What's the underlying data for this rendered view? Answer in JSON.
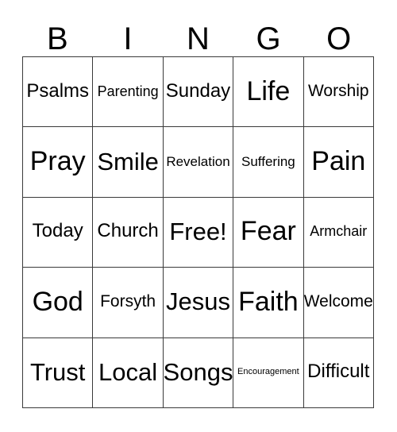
{
  "card": {
    "type": "bingo-card",
    "header_letters": [
      "B",
      "I",
      "N",
      "G",
      "O"
    ],
    "grid_size": "5x5",
    "colors": {
      "background": "#ffffff",
      "text": "#000000",
      "grid_line": "#3a3a3a"
    },
    "rows": [
      [
        {
          "label": "Psalms",
          "size": "md"
        },
        {
          "label": "Parenting",
          "size": "xs"
        },
        {
          "label": "Sunday",
          "size": "md"
        },
        {
          "label": "Life",
          "size": "xl"
        },
        {
          "label": "Worship",
          "size": "sm"
        }
      ],
      [
        {
          "label": "Pray",
          "size": "xl"
        },
        {
          "label": "Smile",
          "size": "lg"
        },
        {
          "label": "Revelation",
          "size": "xxs"
        },
        {
          "label": "Suffering",
          "size": "xxs"
        },
        {
          "label": "Pain",
          "size": "xl"
        }
      ],
      [
        {
          "label": "Today",
          "size": "md"
        },
        {
          "label": "Church",
          "size": "md"
        },
        {
          "label": "Free!",
          "size": "lg"
        },
        {
          "label": "Fear",
          "size": "xl"
        },
        {
          "label": "Armchair",
          "size": "xs"
        }
      ],
      [
        {
          "label": "God",
          "size": "xl"
        },
        {
          "label": "Forsyth",
          "size": "sm"
        },
        {
          "label": "Jesus",
          "size": "lg"
        },
        {
          "label": "Faith",
          "size": "xl"
        },
        {
          "label": "Welcome",
          "size": "sm"
        }
      ],
      [
        {
          "label": "Trust",
          "size": "lg"
        },
        {
          "label": "Local",
          "size": "lg"
        },
        {
          "label": "Songs",
          "size": "lg"
        },
        {
          "label": "Encouragement",
          "size": "tiny"
        },
        {
          "label": "Difficult",
          "size": "md"
        }
      ]
    ]
  }
}
